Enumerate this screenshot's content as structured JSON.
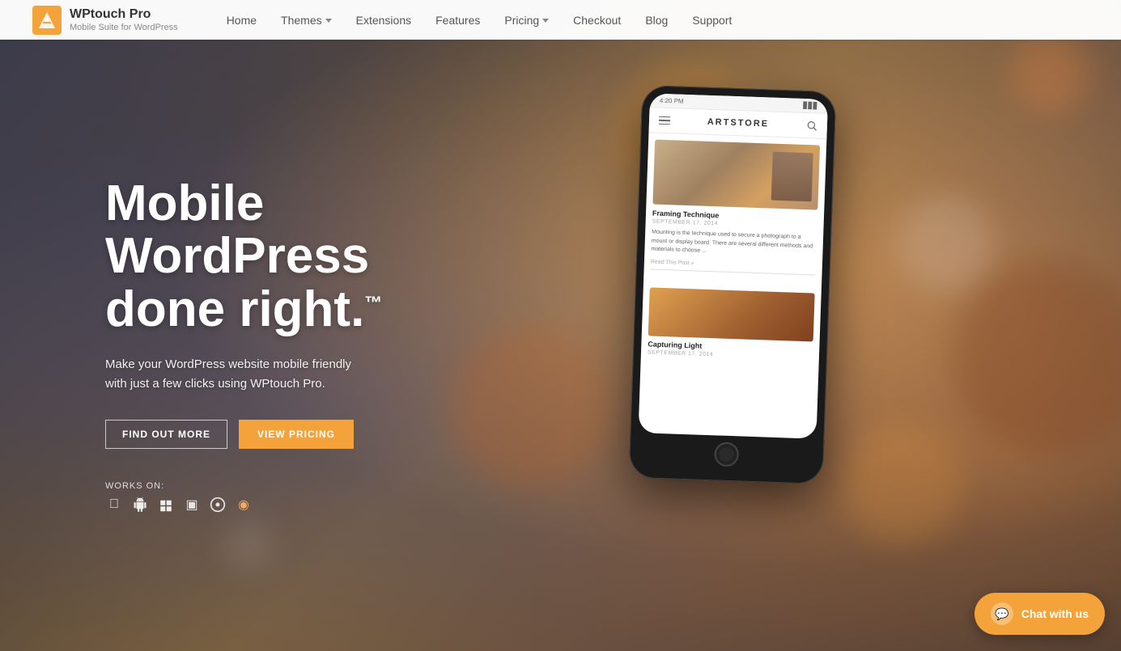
{
  "brand": {
    "name": "WPtouch Pro",
    "tagline": "Mobile Suite for WordPress",
    "logo_color": "#f4a23a"
  },
  "nav": {
    "links": [
      {
        "label": "Home",
        "has_dropdown": false,
        "href": "#"
      },
      {
        "label": "Themes",
        "has_dropdown": true,
        "href": "#"
      },
      {
        "label": "Extensions",
        "has_dropdown": false,
        "href": "#"
      },
      {
        "label": "Features",
        "has_dropdown": false,
        "href": "#"
      },
      {
        "label": "Pricing",
        "has_dropdown": true,
        "href": "#"
      },
      {
        "label": "Checkout",
        "has_dropdown": false,
        "href": "#"
      },
      {
        "label": "Blog",
        "has_dropdown": false,
        "href": "#"
      },
      {
        "label": "Support",
        "has_dropdown": false,
        "href": "#"
      }
    ]
  },
  "hero": {
    "title_line1": "Mobile",
    "title_line2": "WordPress",
    "title_line3": "done right.",
    "title_trademark": "™",
    "description_line1": "Make your WordPress website mobile friendly",
    "description_line2": "with just a few clicks using WPtouch Pro.",
    "btn_find_out": "FIND OUT MORE",
    "btn_view_pricing": "VIEW PRICING",
    "works_on_label": "WORKS ON:",
    "platforms": [
      "apple",
      "android",
      "windows-phone",
      "blackberry",
      "ubuntu",
      "firefox-os"
    ]
  },
  "phone": {
    "app_name": "ARTSTORE",
    "time": "4:20 PM",
    "post1": {
      "title": "Framing Technique",
      "date": "SEPTEMBER 17, 2014",
      "body": "Mounting is the technique used to secure a photograph to a mount or display board. There are several different methods and materials to choose ...",
      "read_more": "Read This Post »"
    },
    "post2": {
      "title": "Capturing Light",
      "date": "SEPTEMBER 17, 2014"
    }
  },
  "chat": {
    "icon": "💬",
    "label": "Chat with us"
  },
  "colors": {
    "accent": "#f4a23a",
    "nav_bg": "#ffffff",
    "hero_text": "#ffffff"
  }
}
